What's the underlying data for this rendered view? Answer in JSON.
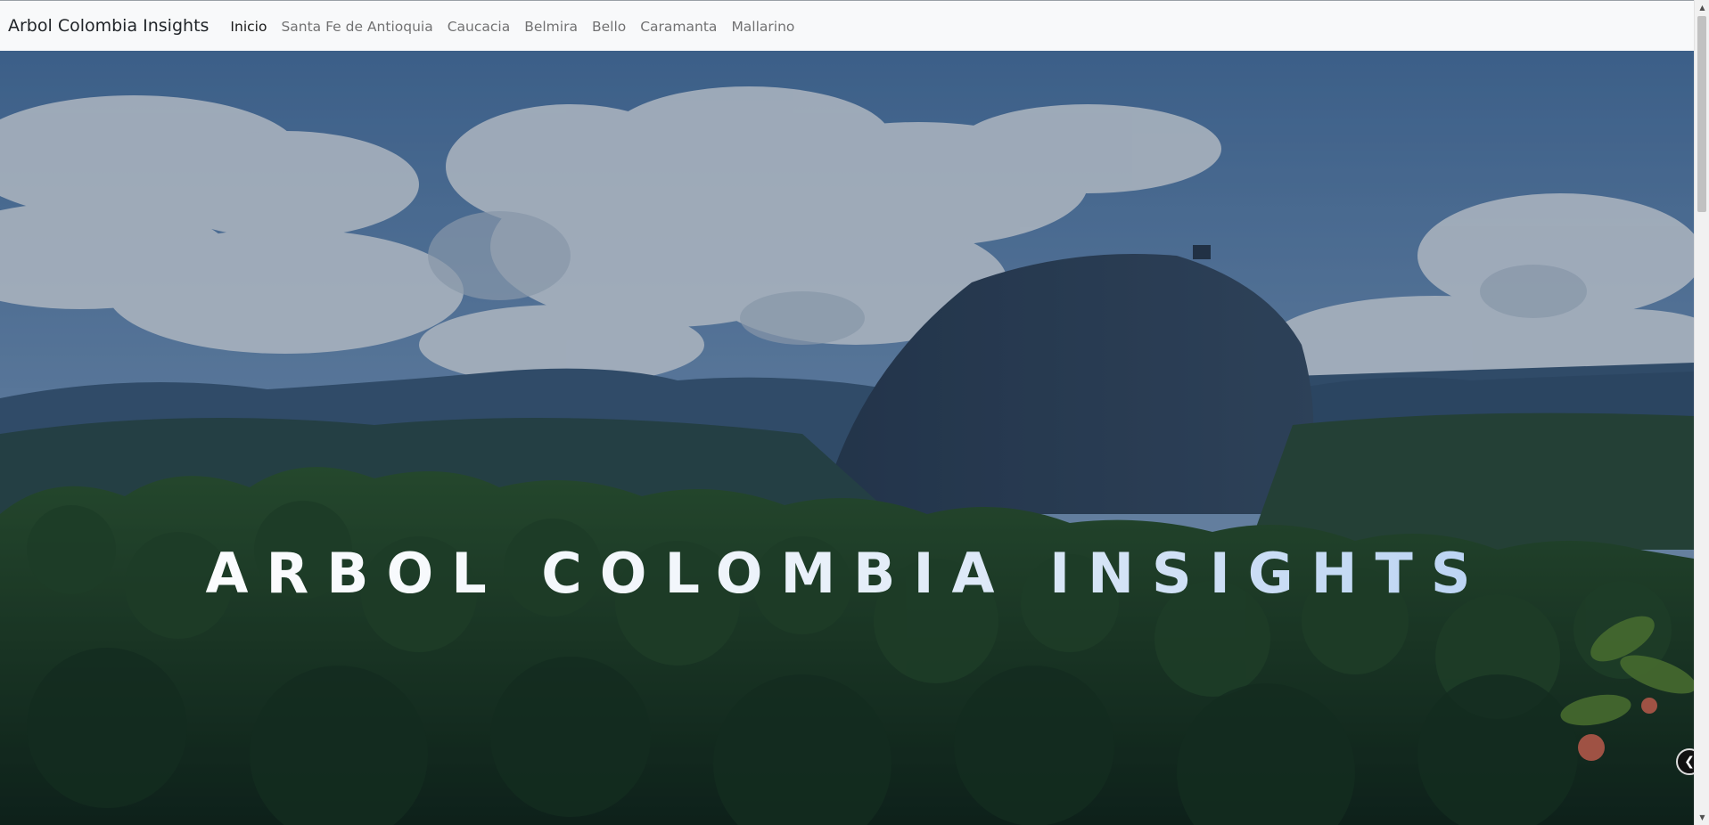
{
  "navbar": {
    "brand": "Arbol Colombia Insights",
    "links": [
      {
        "label": "Inicio",
        "active": true
      },
      {
        "label": "Santa Fe de Antioquia",
        "active": false
      },
      {
        "label": "Caucacia",
        "active": false
      },
      {
        "label": "Belmira",
        "active": false
      },
      {
        "label": "Bello",
        "active": false
      },
      {
        "label": "Caramanta",
        "active": false
      },
      {
        "label": "Mallarino",
        "active": false
      }
    ]
  },
  "hero": {
    "title": "ARBOL COLOMBIA INSIGHTS"
  },
  "colors": {
    "navbar_bg": "#f8f9fa",
    "brand": "#212529",
    "title_gradient_end": "#aecbf3"
  },
  "icons": {
    "side_toggle": "chevron-left-icon",
    "scroll_up": "triangle-up-icon",
    "scroll_down": "triangle-down-icon"
  }
}
